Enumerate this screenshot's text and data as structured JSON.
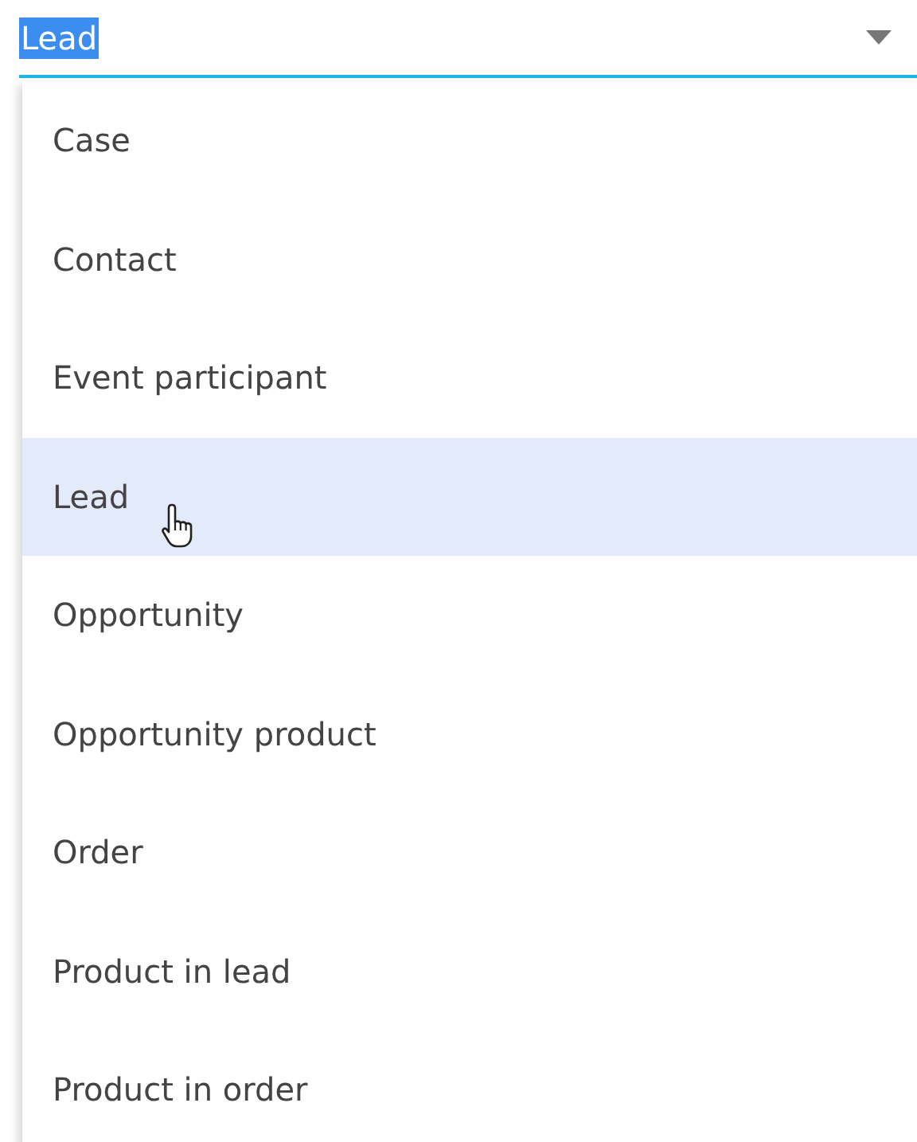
{
  "field": {
    "value": "Lead",
    "text_selected": true,
    "expanded": true
  },
  "options": [
    {
      "label": "Case",
      "selected": false
    },
    {
      "label": "Contact",
      "selected": false
    },
    {
      "label": "Event participant",
      "selected": false
    },
    {
      "label": "Lead",
      "selected": true
    },
    {
      "label": "Opportunity",
      "selected": false
    },
    {
      "label": "Opportunity product",
      "selected": false
    },
    {
      "label": "Order",
      "selected": false
    },
    {
      "label": "Product in lead",
      "selected": false
    },
    {
      "label": "Product in order",
      "selected": false
    }
  ]
}
